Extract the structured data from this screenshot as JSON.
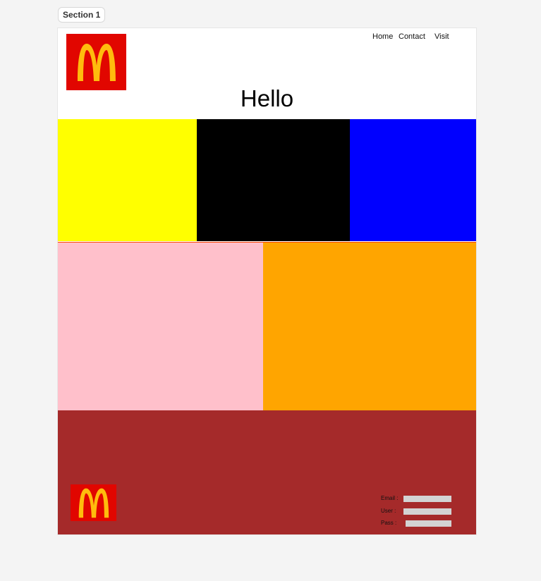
{
  "section": {
    "label": "Section 1"
  },
  "header": {
    "logo_icon": "mcdonalds-golden-arches-icon",
    "nav": [
      {
        "label": "Home"
      },
      {
        "label": "Contact"
      },
      {
        "label": "Visit"
      }
    ],
    "heading": "Hello"
  },
  "colors": {
    "logo_background": "#e10600",
    "arches": "#ffbc0d",
    "block_yellow": "#ffff00",
    "block_black": "#000000",
    "block_blue": "#0000ff",
    "block_pink": "#ffc0cb",
    "block_orange": "#ffa500",
    "footer": "#a52a2a",
    "row_divider": "#ff4500",
    "input_fill": "#d3d3d3"
  },
  "footer": {
    "logo_icon": "mcdonalds-golden-arches-icon",
    "form": {
      "email_label": "Email :",
      "user_label": "User :",
      "pass_label": "Pass :"
    }
  }
}
